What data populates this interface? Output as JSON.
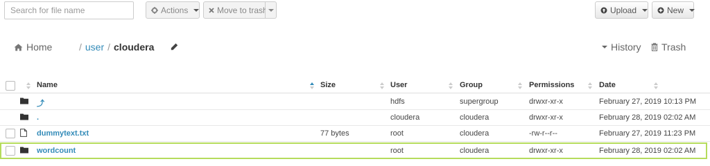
{
  "search": {
    "placeholder": "Search for file name"
  },
  "toolbar": {
    "actions_label": "Actions",
    "move_to_trash_label": "Move to trash",
    "upload_label": "Upload",
    "new_label": "New"
  },
  "breadcrumb": {
    "home_label": "Home",
    "separator": "/",
    "path": [
      "user",
      "cloudera"
    ]
  },
  "right_links": {
    "history_label": "History",
    "trash_label": "Trash"
  },
  "table": {
    "columns": [
      "Name",
      "Size",
      "User",
      "Group",
      "Permissions",
      "Date"
    ],
    "rows": [
      {
        "type": "folder",
        "name": "⤴",
        "size": "",
        "user": "hdfs",
        "group": "supergroup",
        "permissions": "drwxr-xr-x",
        "date": "February 27, 2019 10:13 PM"
      },
      {
        "type": "folder",
        "name": ".",
        "size": "",
        "user": "cloudera",
        "group": "cloudera",
        "permissions": "drwxr-xr-x",
        "date": "February 28, 2019 02:02 AM"
      },
      {
        "type": "file",
        "name": "dummytext.txt",
        "size": "77 bytes",
        "user": "root",
        "group": "cloudera",
        "permissions": "-rw-r--r--",
        "date": "February 27, 2019 11:23 PM"
      },
      {
        "type": "folder",
        "name": "wordcount",
        "size": "",
        "user": "root",
        "group": "cloudera",
        "permissions": "drwxr-xr-x",
        "date": "February 28, 2019 02:02 AM"
      }
    ]
  },
  "colors": {
    "link": "#338bb8",
    "highlight": "#b5dc5c",
    "sort_active": "#338bb8"
  }
}
